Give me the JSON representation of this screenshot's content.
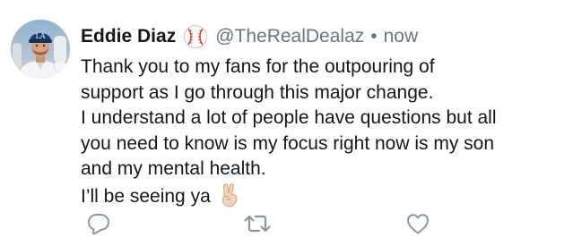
{
  "tweet": {
    "author_name": "Eddie Diaz",
    "verified_badge_icon": "baseball-icon",
    "handle": "@TheRealDealaz",
    "separator": "•",
    "timestamp": "now",
    "body_lines": [
      "Thank you to my fans for the outpouring of",
      "support as I go through this major change.",
      "I understand a lot of people have questions but all",
      "you need to know is my focus right now is my son",
      "and my mental health.",
      "I’ll be seeing ya"
    ],
    "closing_emoji_icon": "victory-hand-icon"
  },
  "actions": {
    "reply_icon": "reply-bubble-icon",
    "retweet_icon": "retweet-icon",
    "like_icon": "heart-icon"
  },
  "colors": {
    "text": "#14171a",
    "secondary": "#657786",
    "icon": "#8899a6",
    "background": "#ffffff"
  }
}
